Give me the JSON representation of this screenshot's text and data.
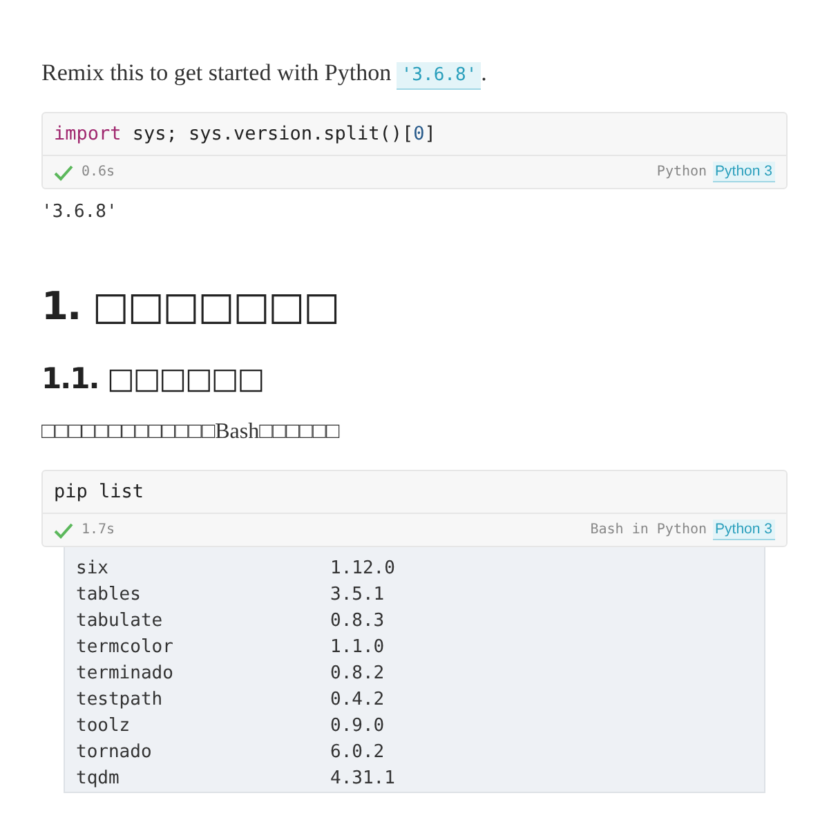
{
  "intro": {
    "text": "Remix this to get started with Python",
    "code": "'3.6.8'",
    "end": "."
  },
  "cells": [
    {
      "code": [
        {
          "kind": "keyword",
          "text": "import"
        },
        {
          "kind": "plain",
          "text": " sys; sys.version.split()["
        },
        {
          "kind": "number",
          "text": "0"
        },
        {
          "kind": "plain",
          "text": "]"
        }
      ],
      "time": "0.6s",
      "language": "Python",
      "kernel": "Python 3",
      "output": "'3.6.8'"
    }
  ],
  "heading_1": "1. □□□□□□□",
  "heading_2": "1.1. □□□□□□",
  "paragraph": "□□□□□□□□□□□□□Bash□□□□□□",
  "cell_2": {
    "code": [
      {
        "kind": "plain",
        "text": "pip list"
      }
    ],
    "time": "1.7s",
    "language": "Bash in Python",
    "kernel": "Python 3"
  },
  "packages": [
    {
      "name": "six",
      "version": "1.12.0"
    },
    {
      "name": "tables",
      "version": "3.5.1"
    },
    {
      "name": "tabulate",
      "version": "0.8.3"
    },
    {
      "name": "termcolor",
      "version": "1.1.0"
    },
    {
      "name": "terminado",
      "version": "0.8.2"
    },
    {
      "name": "testpath",
      "version": "0.4.2"
    },
    {
      "name": "toolz",
      "version": "0.9.0"
    },
    {
      "name": "tornado",
      "version": "6.0.2"
    },
    {
      "name": "tqdm",
      "version": "4.31.1"
    }
  ]
}
